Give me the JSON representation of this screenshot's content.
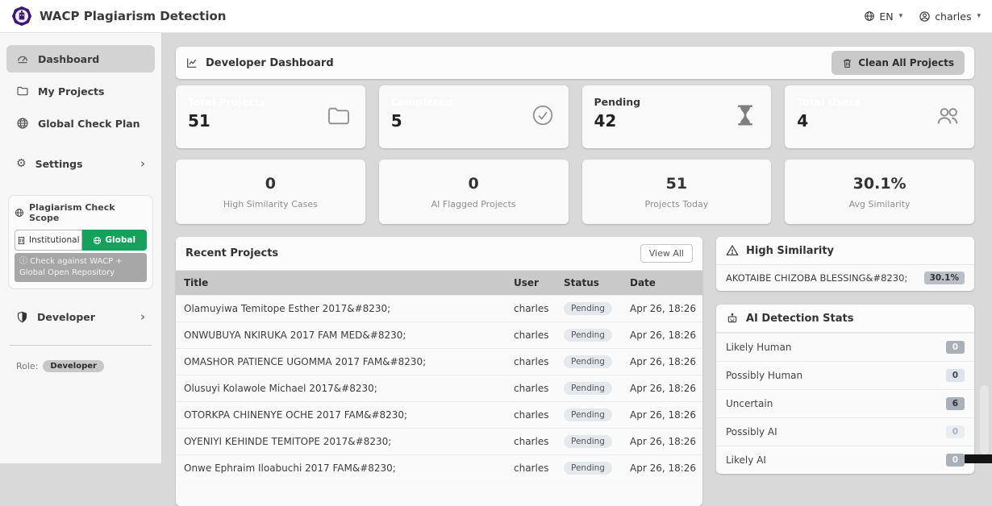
{
  "header": {
    "app_title": "WACP Plagiarism Detection",
    "language": "EN",
    "username": "charles"
  },
  "sidebar": {
    "nav": [
      {
        "label": "Dashboard"
      },
      {
        "label": "My Projects"
      },
      {
        "label": "Global Check Plan"
      },
      {
        "label": "Settings"
      }
    ],
    "scope": {
      "title": "Plagiarism Check Scope",
      "institutional": "Institutional",
      "global": "Global",
      "tooltip": "ⓘ Check against WACP + Global Open Repository"
    },
    "developer": "Developer",
    "role_label": "Role:",
    "role_value": "Developer"
  },
  "main": {
    "title": "Developer Dashboard",
    "clean_button": "Clean All Projects",
    "stats": [
      {
        "label": "Total Projects",
        "value": "51"
      },
      {
        "label": "Completed",
        "value": "5"
      },
      {
        "label": "Pending",
        "value": "42"
      },
      {
        "label": "Total Users",
        "value": "4"
      }
    ],
    "metrics": [
      {
        "value": "0",
        "label": "High Similarity Cases"
      },
      {
        "value": "0",
        "label": "AI Flagged Projects"
      },
      {
        "value": "51",
        "label": "Projects Today"
      },
      {
        "value": "30.1%",
        "label": "Avg Similarity"
      }
    ],
    "recent": {
      "title": "Recent Projects",
      "view_all": "View All",
      "columns": [
        "Title",
        "User",
        "Status",
        "Date"
      ],
      "rows": [
        {
          "title": "Olamuyiwa Temitope Esther 2017&#8230;",
          "user": "charles",
          "status": "Pending",
          "date": "Apr 26, 18:26"
        },
        {
          "title": "ONWUBUYA NKIRUKA 2017 FAM MED&#8230;",
          "user": "charles",
          "status": "Pending",
          "date": "Apr 26, 18:26"
        },
        {
          "title": "OMASHOR PATIENCE UGOMMA 2017 FAM&#8230;",
          "user": "charles",
          "status": "Pending",
          "date": "Apr 26, 18:26"
        },
        {
          "title": "Olusuyi Kolawole Michael 2017&#8230;",
          "user": "charles",
          "status": "Pending",
          "date": "Apr 26, 18:26"
        },
        {
          "title": "OTORKPA CHINENYE OCHE 2017 FAM&#8230;",
          "user": "charles",
          "status": "Pending",
          "date": "Apr 26, 18:26"
        },
        {
          "title": "OYENIYI KEHINDE TEMITOPE 2017&#8230;",
          "user": "charles",
          "status": "Pending",
          "date": "Apr 26, 18:26"
        },
        {
          "title": "Onwe Ephraim Iloabuchi 2017 FAM&#8230;",
          "user": "charles",
          "status": "Pending",
          "date": "Apr 26, 18:26"
        }
      ]
    },
    "high_similarity": {
      "title": "High Similarity",
      "items": [
        {
          "name": "AKOTAIBE CHIZOBA BLESSING&#8230;",
          "value": "30.1%"
        }
      ]
    },
    "ai_stats": {
      "title": "AI Detection Stats",
      "rows": [
        {
          "label": "Likely Human",
          "value": "0"
        },
        {
          "label": "Possibly Human",
          "value": "0"
        },
        {
          "label": "Uncertain",
          "value": "6"
        },
        {
          "label": "Possibly AI",
          "value": "0"
        },
        {
          "label": "Likely AI",
          "value": "0"
        }
      ]
    }
  },
  "colors": {
    "brand_purple": "#3c1970",
    "accent_green": "#14a15b",
    "page_bg": "#d9d9d9"
  }
}
